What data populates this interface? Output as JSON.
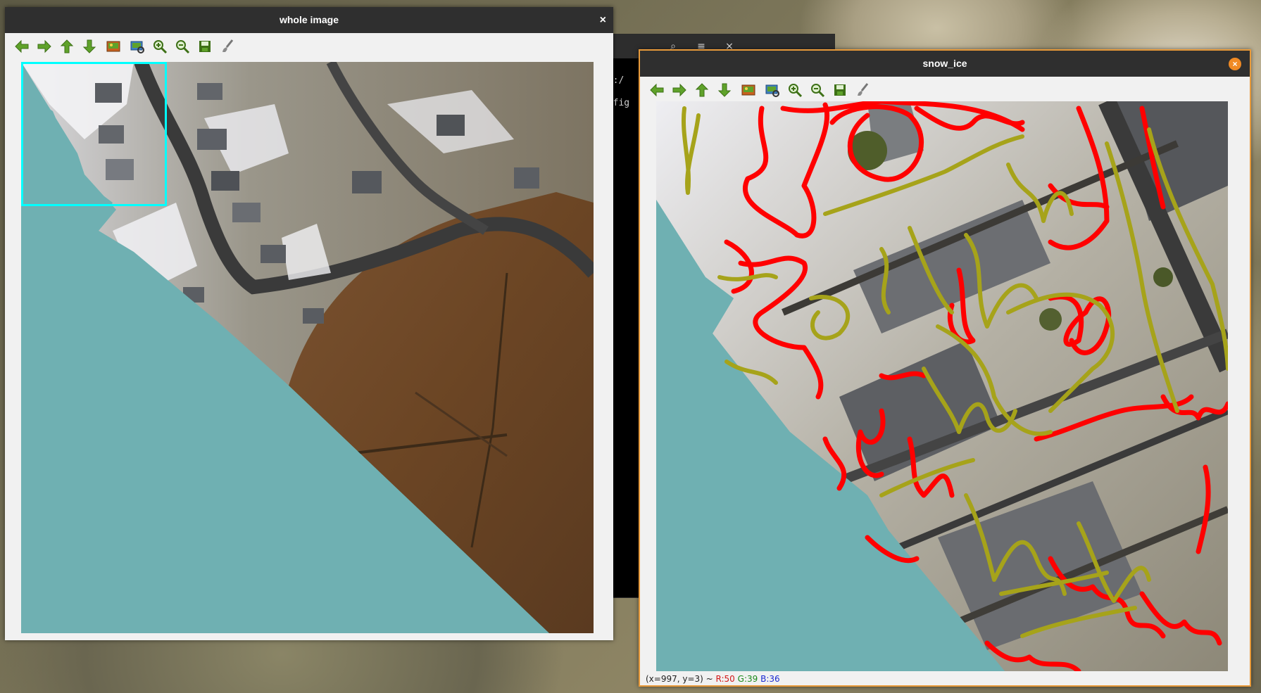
{
  "windows": {
    "whole": {
      "title": "whole image",
      "close_label": "×"
    },
    "snow": {
      "title": "snow_ice",
      "close_label": "×",
      "status": {
        "coords": "(x=997, y=3) ~ ",
        "r": "R:50",
        "g": "G:39",
        "b": "B:36"
      }
    }
  },
  "terminal": {
    "line1": "os:/",
    "line2": "onfig",
    "search_label": "⌕",
    "menu_label": "≡",
    "close_label": "×"
  },
  "toolbar_icons": [
    "arrow-left-icon",
    "arrow-right-icon",
    "arrow-up-icon",
    "arrow-down-icon",
    "zoom-fit-icon",
    "zoom-original-icon",
    "zoom-in-icon",
    "zoom-out-icon",
    "save-icon",
    "properties-brush-icon"
  ],
  "colors": {
    "mask_teal": "#6fb0b2",
    "selection_cyan": "#00ffff",
    "annotation_red": "#ff0000",
    "annotation_olive": "#a6a31a",
    "toolbar_green": "#5fa22a"
  }
}
